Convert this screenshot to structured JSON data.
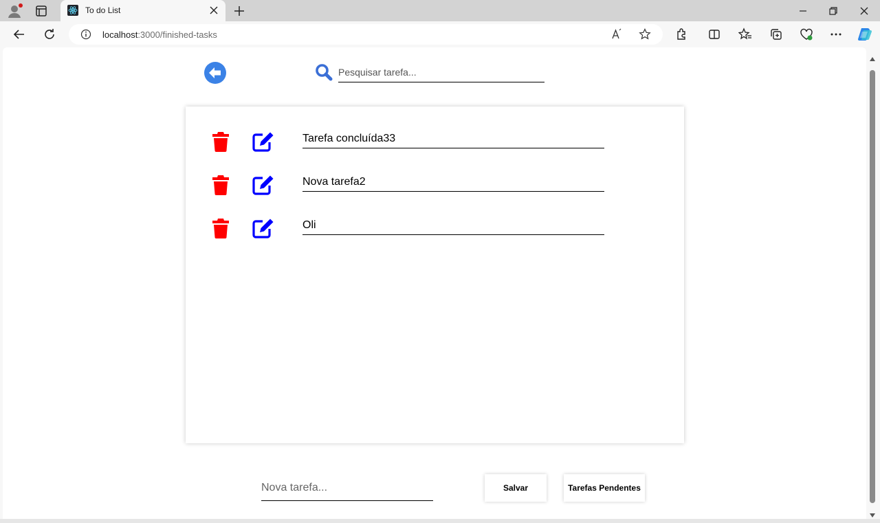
{
  "browser": {
    "tab_title": "To do List",
    "url_host": "localhost",
    "url_path": ":3000/finished-tasks"
  },
  "app": {
    "search": {
      "placeholder": "Pesquisar tarefa..."
    },
    "tasks": [
      {
        "text": "Tarefa concluída33"
      },
      {
        "text": "Nova tarefa2"
      },
      {
        "text": "Oli"
      }
    ],
    "new_task": {
      "placeholder": "Nova tarefa..."
    },
    "save_label": "Salvar",
    "pending_label": "Tarefas Pendentes"
  },
  "colors": {
    "back_icon": "#3b82e6",
    "trash_icon": "#ff0000",
    "edit_icon": "#0000ff",
    "search_icon": "#3b6fd6"
  },
  "icons": {
    "back": "arrow-circle-left-icon",
    "search": "magnifier-icon",
    "delete": "trash-icon",
    "edit": "pen-to-square-icon"
  }
}
